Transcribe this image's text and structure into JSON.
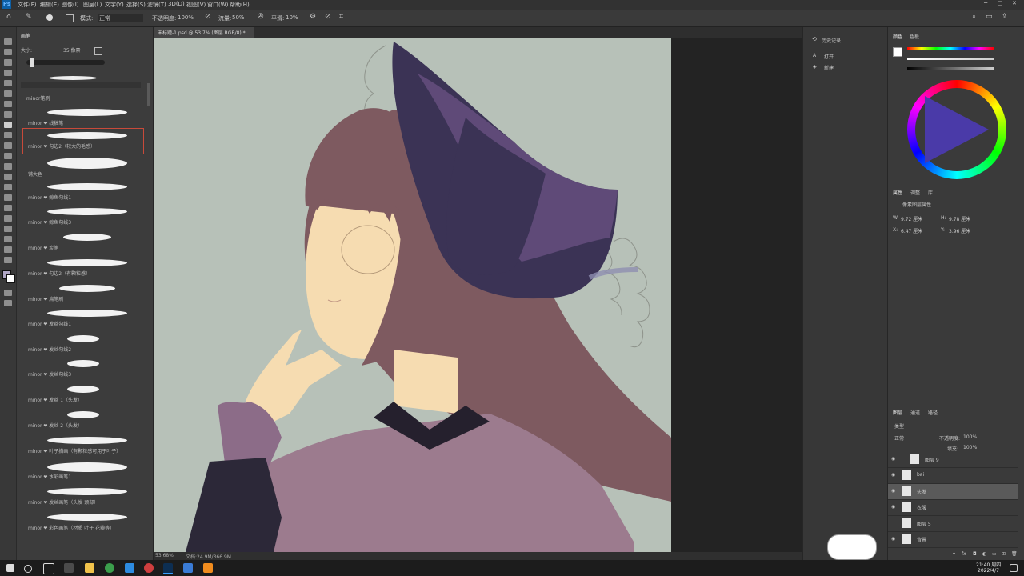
{
  "menu": [
    "文件(F)",
    "编辑(E)",
    "图像(I)",
    "图层(L)",
    "文字(Y)",
    "选择(S)",
    "滤镜(T)",
    "3D(D)",
    "视图(V)",
    "窗口(W)",
    "帮助(H)"
  ],
  "options_bar": {
    "mode_label": "模式:",
    "mode_value": "正常",
    "opacity_label": "不透明度:",
    "opacity_value": "100%",
    "flow_label": "流量:",
    "flow_value": "50%",
    "smooth_label": "平滑:",
    "smooth_value": "10%"
  },
  "brush_panel": {
    "title": "画笔",
    "size_label": "大小:",
    "size_value": "35 像素",
    "group_label": "minor笔刷",
    "brushes": [
      "minor ❤ 线稿笔",
      "minor ❤ 勾边2（较大的毛感）",
      "铺大色",
      "minor ❤ 鲸鱼勾线1",
      "minor ❤ 鲸鱼勾线3",
      "minor ❤ 炭笔",
      "minor ❤ 勾边2（有颗粒感）",
      "minor ❤ 扁笔刷",
      "minor ❤ 发丝勾线1",
      "minor ❤ 发丝勾线2",
      "minor ❤ 发丝勾线3",
      "minor ❤ 发丝 1（头发）",
      "minor ❤ 发丝 2（头发）",
      "minor ❤ 叶子描画（有颗粒感可用于叶子）",
      "minor ❤ 水彩画笔1",
      "minor ❤ 发丝画笔（头发 颈部）",
      "minor ❤ 彩色画笔（材质 叶子 花瓣等）"
    ]
  },
  "document": {
    "tab_label": "未标题-1.psd @ 53.7% (图层 RGB/8) *",
    "zoom_status": "53.68%",
    "file_status": "文档:24.9M/366.9M"
  },
  "history_panel": {
    "title": "历史记录",
    "items": [
      "打开",
      "新建"
    ]
  },
  "color_panel": {
    "title": "颜色",
    "tab2": "色板"
  },
  "properties_panel": {
    "tabs": [
      "属性",
      "调整",
      "库"
    ],
    "subtitle": "像素图层属性",
    "w_label": "W:",
    "w_value": "9.72 厘米",
    "h_label": "H:",
    "h_value": "9.78 厘米",
    "x_label": "X:",
    "x_value": "6.47 厘米",
    "y_label": "Y:",
    "y_value": "3.96 厘米"
  },
  "layers_panel": {
    "tabs": [
      "图层",
      "通道",
      "路径"
    ],
    "kind_label": "类型",
    "blend_mode": "正常",
    "opacity_label": "不透明度:",
    "opacity_value": "100%",
    "fill_label": "填充:",
    "fill_value": "100%",
    "layers": [
      "图层 9",
      "bai",
      "头发",
      "衣服",
      "图层 5",
      "背景"
    ]
  },
  "taskbar": {
    "time": "21:40 周四",
    "date": "2022/4/7"
  },
  "colors": {
    "canvas_bg": "#b7c1b8",
    "hat_dark": "#3b3355",
    "hat_purple": "#5f4a78",
    "hair": "#7e5a60",
    "skin": "#f6dcb1",
    "collar": "#25202d",
    "cape": "#9c7b8e",
    "sleeve": "#8c6c88",
    "accent": "#cf3f3f"
  }
}
